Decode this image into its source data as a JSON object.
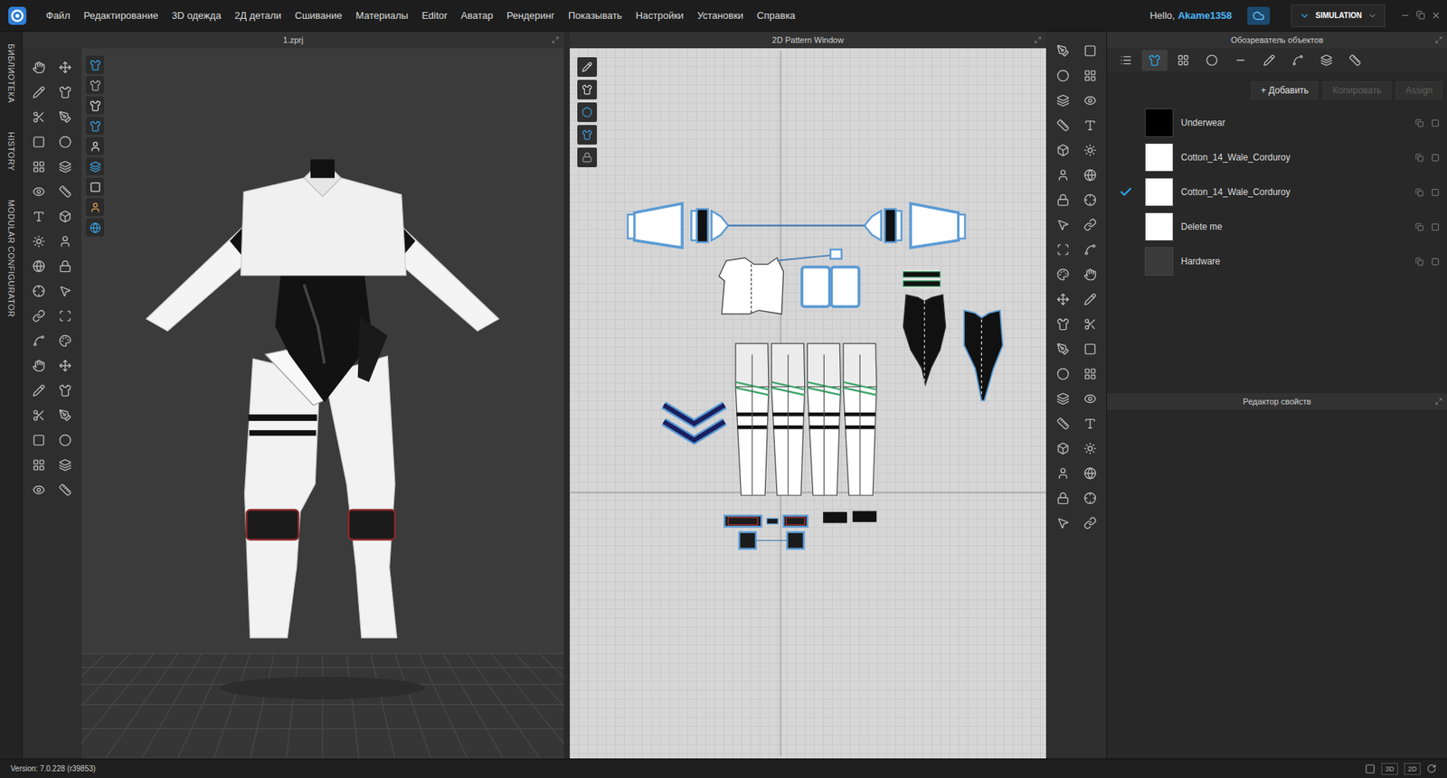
{
  "menu": [
    "Файл",
    "Редактирование",
    "3D одежда",
    "2Д детали",
    "Сшивание",
    "Материалы",
    "Editor",
    "Аватар",
    "Рендеринг",
    "Показывать",
    "Настройки",
    "Установки",
    "Справка"
  ],
  "user": {
    "greeting": "Hello,",
    "name": "Akame1358"
  },
  "mode": "SIMULATION",
  "side_tabs": [
    "БИБЛИОТЕКА",
    "HISTORY",
    "MODULAR CONFIGURATOR"
  ],
  "viewport_3d": {
    "title": "1.zprj"
  },
  "pattern_window": {
    "title": "2D Pattern Window"
  },
  "object_browser": {
    "title": "Обозреватель объектов",
    "tabs": [
      {
        "selected": false
      },
      {
        "selected": true
      },
      {
        "selected": false
      },
      {
        "selected": false
      },
      {
        "selected": false
      },
      {
        "selected": false
      },
      {
        "selected": false
      },
      {
        "selected": false
      },
      {
        "selected": false
      }
    ],
    "buttons": [
      {
        "label": "+ Добавить",
        "disabled": false
      },
      {
        "label": "Копировать",
        "disabled": true
      },
      {
        "label": "Assign",
        "disabled": true
      }
    ],
    "materials": [
      {
        "name": "Underwear",
        "checked": false,
        "color": "#000000"
      },
      {
        "name": "Cotton_14_Wale_Corduroy",
        "checked": false,
        "color": "#ffffff"
      },
      {
        "name": "Cotton_14_Wale_Corduroy",
        "checked": true,
        "color": "#ffffff"
      },
      {
        "name": "Delete me",
        "checked": false,
        "color": "#ffffff"
      },
      {
        "name": "Hardware",
        "checked": false,
        "color": "#3a3a3a"
      }
    ]
  },
  "property_editor": {
    "title": "Редактор свойств"
  },
  "status_bar": {
    "version": "Version: 7.0.228 (r39853)",
    "view_buttons": [
      "3D",
      "2D"
    ]
  }
}
